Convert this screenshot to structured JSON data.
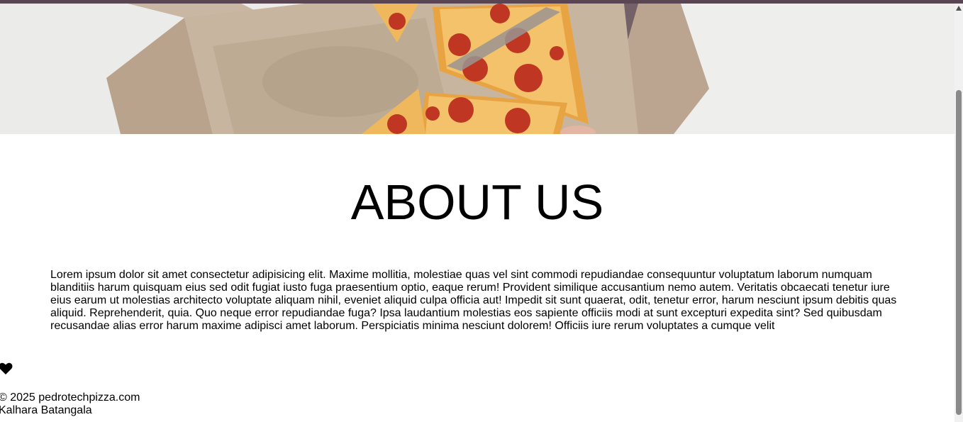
{
  "hero": {
    "image": "pizza-box-photo"
  },
  "about": {
    "title": "ABOUT US",
    "body": "Lorem ipsum dolor sit amet consectetur adipisicing elit. Maxime mollitia, molestiae quas vel sint commodi repudiandae consequuntur voluptatum laborum numquam blanditiis harum quisquam eius sed odit fugiat iusto fuga praesentium optio, eaque rerum! Provident similique accusantium nemo autem. Veritatis obcaecati tenetur iure eius earum ut molestias architecto voluptate aliquam nihil, eveniet aliquid culpa officia aut! Impedit sit sunt quaerat, odit, tenetur error, harum nesciunt ipsum debitis quas aliquid. Reprehenderit, quia. Quo neque error repudiandae fuga? Ipsa laudantium molestias eos sapiente officiis modi at sunt excepturi expedita sint? Sed quibusdam recusandae alias error harum maxime adipisci amet laborum. Perspiciatis minima nesciunt dolorem! Officiis iure rerum voluptates a cumque velit"
  },
  "footer": {
    "icon": "heart-icon",
    "copyright": "© 2025 pedrotechpizza.com",
    "author": "Kalhara Batangala"
  },
  "colors": {
    "topbar": "#5a4552",
    "cardboard": "#c2ad96",
    "pepperoni": "#c13a22",
    "cheese": "#f2b350",
    "crust": "#d99a45"
  }
}
